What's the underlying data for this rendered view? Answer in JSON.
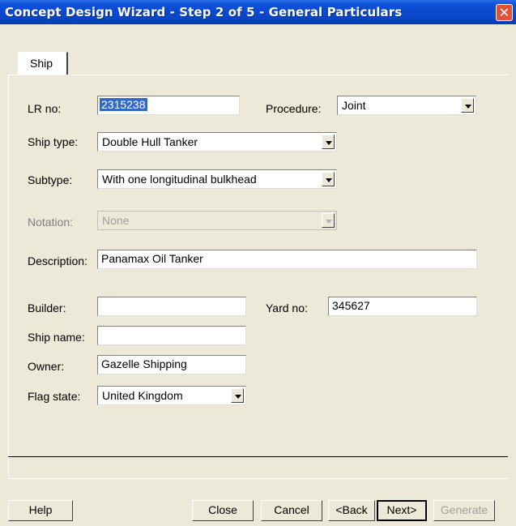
{
  "window": {
    "title": "Concept Design Wizard - Step 2 of 5 - General Particulars",
    "close_glyph": "✕"
  },
  "tabs": [
    {
      "label": "Ship",
      "active": true
    }
  ],
  "form": {
    "lr_no": {
      "label": "LR no:",
      "value": "2315238"
    },
    "procedure": {
      "label": "Procedure:",
      "value": "Joint"
    },
    "ship_type": {
      "label": "Ship type:",
      "value": "Double Hull Tanker"
    },
    "subtype": {
      "label": "Subtype:",
      "value": "With one longitudinal bulkhead"
    },
    "notation": {
      "label": "Notation:",
      "value": "None",
      "disabled": true
    },
    "description": {
      "label": "Description:",
      "value": "Panamax Oil Tanker"
    },
    "builder": {
      "label": "Builder:",
      "value": ""
    },
    "yard_no": {
      "label": "Yard no:",
      "value": "345627"
    },
    "ship_name": {
      "label": "Ship name:",
      "value": ""
    },
    "owner": {
      "label": "Owner:",
      "value": "Gazelle Shipping"
    },
    "flag_state": {
      "label": "Flag state:",
      "value": "United Kingdom"
    }
  },
  "buttons": {
    "help": "Help",
    "close": "Close",
    "cancel": "Cancel",
    "back": "<Back",
    "next": "Next>",
    "generate": {
      "label": "Generate",
      "disabled": true
    }
  },
  "colors": {
    "titlebar": "#0a46c8",
    "dialog_bg": "#ece9d8",
    "selection": "#316ac5",
    "close_button": "#e0523a"
  },
  "icons": [
    "close-icon",
    "dropdown-arrow-icon"
  ]
}
